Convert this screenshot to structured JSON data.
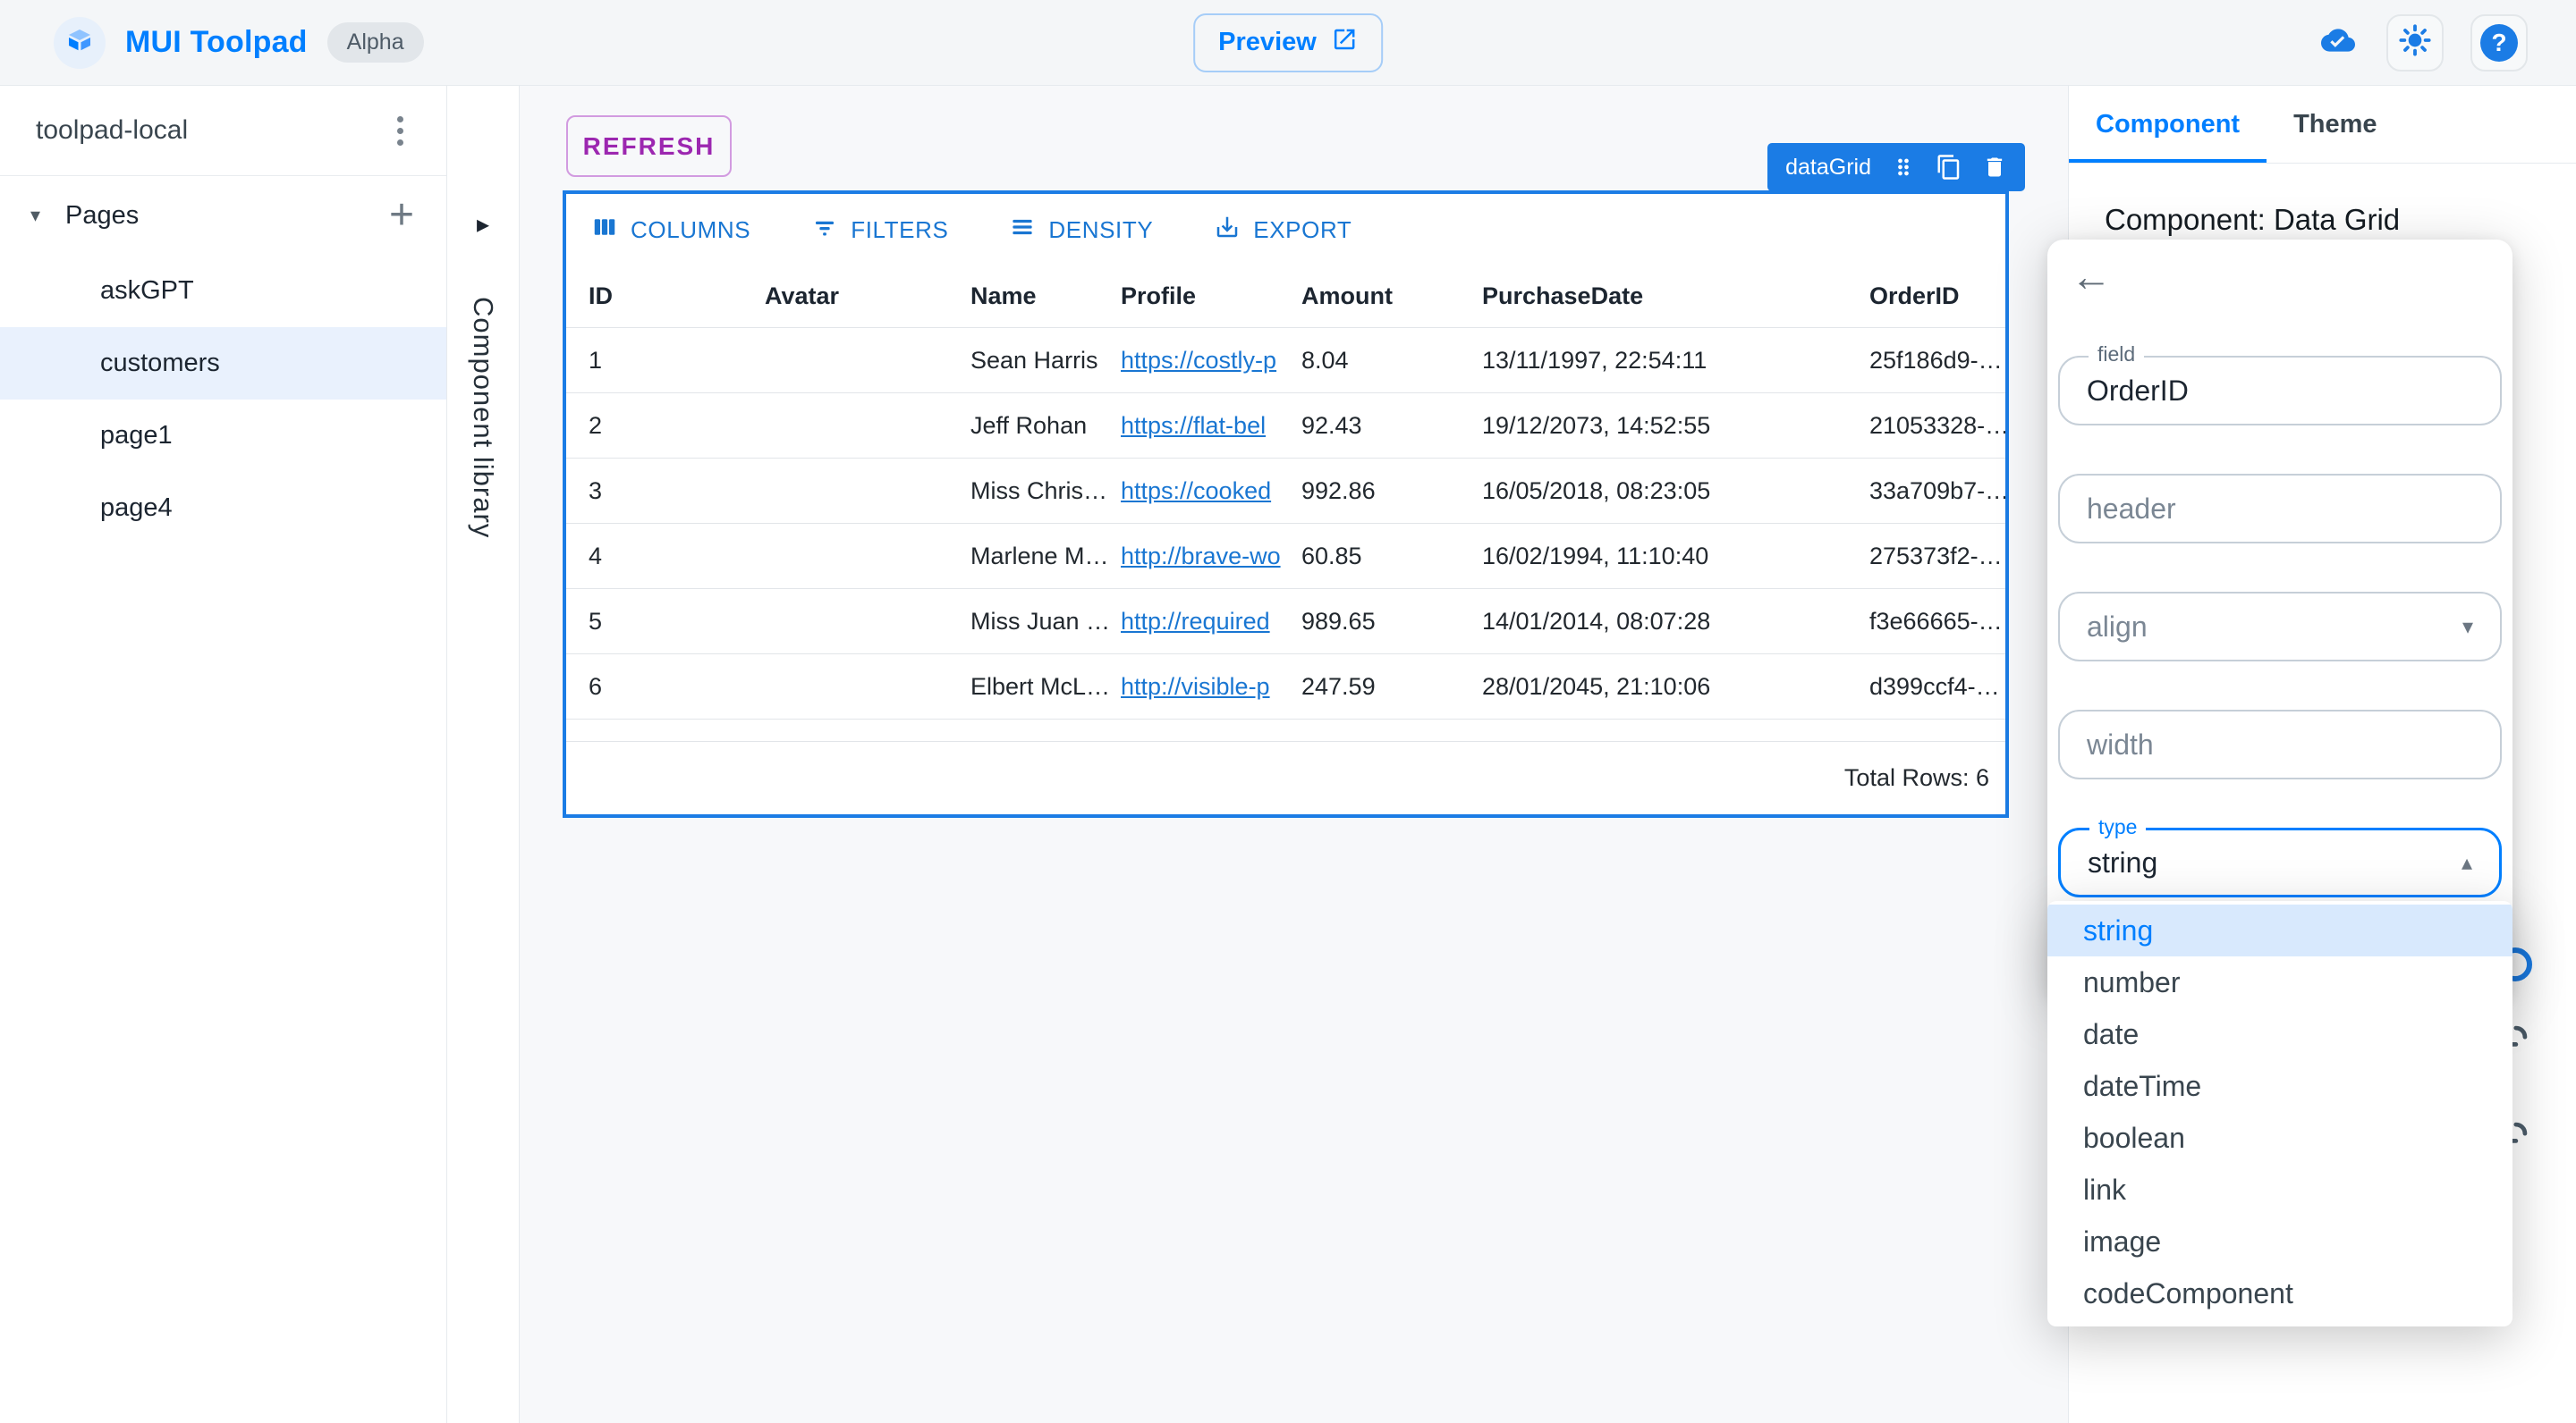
{
  "topbar": {
    "title": "MUI Toolpad",
    "badge": "Alpha",
    "preview_label": "Preview"
  },
  "sidebar": {
    "project_name": "toolpad-local",
    "pages_label": "Pages",
    "items": [
      {
        "label": "askGPT",
        "selected": false
      },
      {
        "label": "customers",
        "selected": true
      },
      {
        "label": "page1",
        "selected": false
      },
      {
        "label": "page4",
        "selected": false
      }
    ]
  },
  "component_library": {
    "label": "Component library"
  },
  "canvas": {
    "refresh_label": "REFRESH",
    "selection": {
      "chip_label": "dataGrid"
    },
    "grid": {
      "toolbar": {
        "columns": "COLUMNS",
        "filters": "FILTERS",
        "density": "DENSITY",
        "export": "EXPORT"
      },
      "columns": [
        "ID",
        "Avatar",
        "Name",
        "Profile",
        "Amount",
        "PurchaseDate",
        "OrderID"
      ],
      "rows": [
        {
          "id": "1",
          "name": "Sean Harris",
          "profile": "https://costly-p",
          "amount": "8.04",
          "purchase_date": "13/11/1997, 22:54:11",
          "order_id": "25f186d9-…",
          "avatar_bg": "linear-gradient(150deg,#c8aa8c 0%,#8a6f56 55%,#57422f 100%)"
        },
        {
          "id": "2",
          "name": "Jeff Rohan",
          "profile": "https://flat-bel",
          "amount": "92.43",
          "purchase_date": "19/12/2073, 14:52:55",
          "order_id": "21053328-…",
          "avatar_bg": "linear-gradient(150deg,#6d6d6d 0%,#2e2e2e 60%,#101010 100%)"
        },
        {
          "id": "3",
          "name": "Miss Chris…",
          "profile": "https://cooked",
          "amount": "992.86",
          "purchase_date": "16/05/2018, 08:23:05",
          "order_id": "33a709b7-…",
          "avatar_bg": "linear-gradient(150deg,#8c8c80 0%,#4a4a40 55%,#1d1d18 100%)"
        },
        {
          "id": "4",
          "name": "Marlene M…",
          "profile": "http://brave-wo",
          "amount": "60.85",
          "purchase_date": "16/02/1994, 11:10:40",
          "order_id": "275373f2-…",
          "avatar_bg": "linear-gradient(150deg,#9a9a9a 0%,#3c3c3c 55%,#141414 100%)"
        },
        {
          "id": "5",
          "name": "Miss Juan …",
          "profile": "http://required",
          "amount": "989.65",
          "purchase_date": "14/01/2014, 08:07:28",
          "order_id": "f3e66665-…",
          "avatar_bg": "linear-gradient(150deg,#d9b968 0%,#a07c3a 55%,#5e4314 100%)"
        },
        {
          "id": "6",
          "name": "Elbert McL…",
          "profile": "http://visible-p",
          "amount": "247.59",
          "purchase_date": "28/01/2045, 21:10:06",
          "order_id": "d399ccf4-…",
          "avatar_bg": "linear-gradient(160deg,#3a3a3a 0%,#8c2626 45%,#c03434 100%)"
        }
      ],
      "footer": "Total Rows: 6"
    }
  },
  "inspector": {
    "tabs": [
      {
        "label": "Component",
        "active": true
      },
      {
        "label": "Theme",
        "active": false
      }
    ],
    "heading": "Component: Data Grid",
    "column_editor": {
      "field_label": "field",
      "field_value": "OrderID",
      "header_placeholder": "header",
      "align_placeholder": "align",
      "width_placeholder": "width",
      "type_label": "type",
      "type_value": "string"
    },
    "type_menu": {
      "selected": "string",
      "options": [
        "string",
        "number",
        "date",
        "dateTime",
        "boolean",
        "link",
        "image",
        "codeComponent"
      ]
    }
  },
  "icons": [
    "toolpad-logo-icon",
    "open-in-new-icon",
    "cloud-done-icon",
    "brightness-icon",
    "help-icon",
    "kebab-icon",
    "caret-down-icon",
    "plus-icon",
    "collapse-arrow-icon",
    "drag-handle-icon",
    "copy-icon",
    "delete-icon",
    "view-columns-icon",
    "filter-icon",
    "density-icon",
    "export-icon",
    "back-arrow-icon",
    "select-open-icon",
    "select-closed-icon",
    "add-link-icon"
  ],
  "colors": {
    "brand_blue": "#007FFF",
    "selection_blue": "#1b7ce5",
    "grid_blue": "#1976d2",
    "refresh_purple": "#9c27b0",
    "selected_page_bg": "#e9f1fd",
    "menu_selected_bg": "#d8e9fd"
  }
}
